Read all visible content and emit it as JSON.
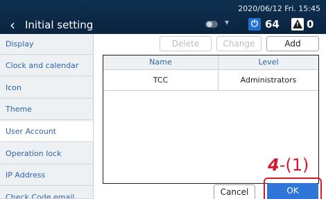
{
  "header": {
    "back_icon": "chevron-left-icon",
    "title": "Initial setting",
    "datetime": "2020/06/12 Fri. 15:45",
    "power_count": "64",
    "warning_count": "0",
    "colors": {
      "bar": "#0e2f4f",
      "power": "#1f6fd0",
      "warning": "#1c1c1c"
    }
  },
  "sidebar": {
    "items": [
      {
        "label": "Display"
      },
      {
        "label": "Clock and calendar"
      },
      {
        "label": "Icon"
      },
      {
        "label": "Theme"
      },
      {
        "label": "User Account",
        "active": true
      },
      {
        "label": "Operation lock"
      },
      {
        "label": "IP Address"
      },
      {
        "label": "Check Code email address"
      }
    ]
  },
  "toolbar": {
    "delete_label": "Delete",
    "change_label": "Change",
    "add_label": "Add"
  },
  "table": {
    "headers": [
      "Name",
      "Level"
    ],
    "rows": [
      {
        "name": "TCC",
        "level": "Administrators"
      }
    ]
  },
  "footer": {
    "cancel_label": "Cancel",
    "ok_label": "OK",
    "accent": "#2f76d8",
    "highlight": "#d2192b"
  },
  "annotation": {
    "number": "4",
    "suffix": "-(1)"
  }
}
